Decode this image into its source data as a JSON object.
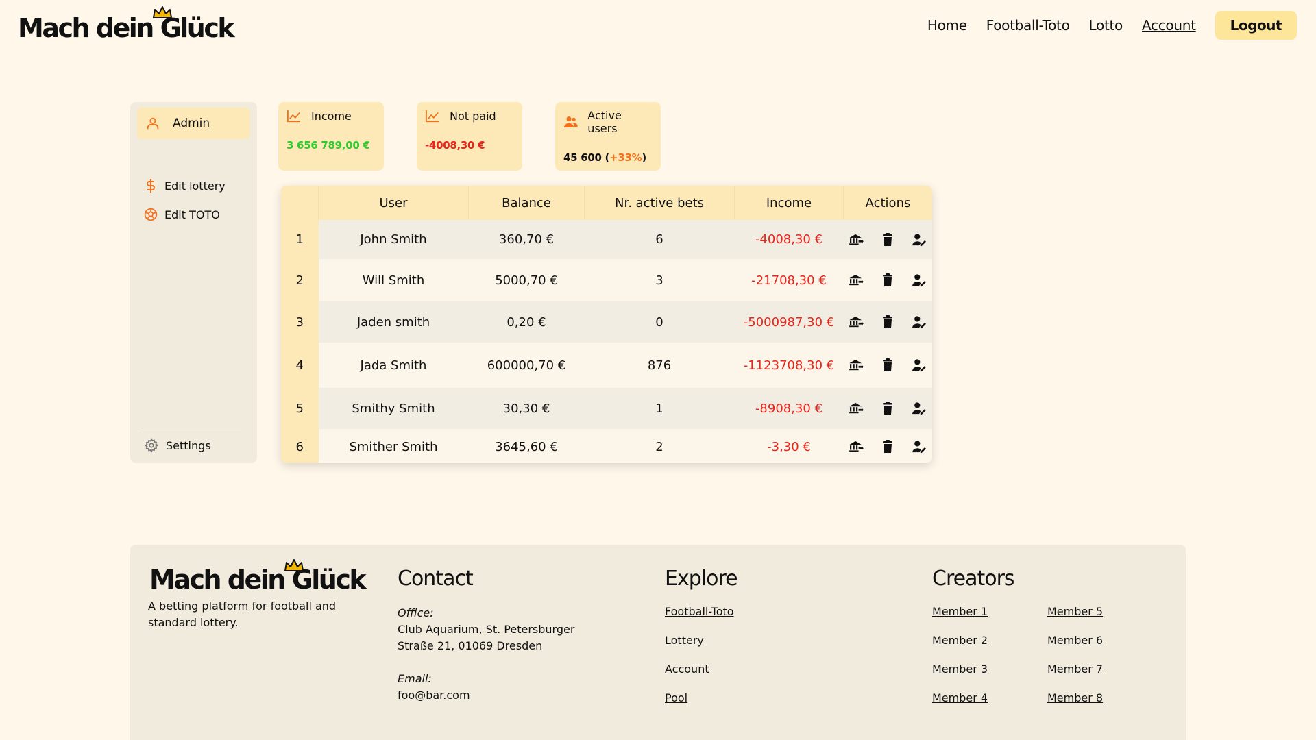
{
  "brand": {
    "name_part1": "Mach dein",
    "name_part2": "Glück"
  },
  "nav": {
    "items": [
      "Home",
      "Football-Toto",
      "Lotto",
      "Account"
    ],
    "logout_label": "Logout"
  },
  "sidebar": {
    "admin_label": "Admin",
    "items": [
      {
        "label": "Edit lottery",
        "icon": "dollar-icon"
      },
      {
        "label": "Edit TOTO",
        "icon": "soccer-ball-icon"
      }
    ],
    "settings_label": "Settings"
  },
  "stats": [
    {
      "label": "Income",
      "value": "3 656 789,00 €",
      "icon": "chart-line-icon"
    },
    {
      "label": "Not paid",
      "value": "-4008,30 €",
      "icon": "chart-line-icon"
    },
    {
      "label": "Active users",
      "value": "45 600",
      "delta": "+33%",
      "icon": "users-icon"
    }
  ],
  "table": {
    "headers": [
      "User",
      "Balance",
      "Nr. active bets",
      "Income",
      "Actions"
    ],
    "rows": [
      {
        "idx": "1",
        "user": "John Smith",
        "balance": "360,70 €",
        "bets": "6",
        "income": "-4008,30 €"
      },
      {
        "idx": "2",
        "user": "Will Smith",
        "balance": "5000,70 €",
        "bets": "3",
        "income": "-21708,30 €"
      },
      {
        "idx": "3",
        "user": "Jaden smith",
        "balance": "0,20 €",
        "bets": "0",
        "income": "-5000987,30 €"
      },
      {
        "idx": "4",
        "user": "Jada Smith",
        "balance": "600000,70 €",
        "bets": "876",
        "income": "-1123708,30 €"
      },
      {
        "idx": "5",
        "user": "Smithy Smith",
        "balance": "30,30 €",
        "bets": "1",
        "income": "-8908,30 €"
      },
      {
        "idx": "6",
        "user": "Smither Smith",
        "balance": "3645,60 €",
        "bets": "2",
        "income": "-3,30 €"
      }
    ]
  },
  "footer": {
    "description": "A betting platform for football and standard lottery.",
    "contact": {
      "title": "Contact",
      "office_label": "Office:",
      "office_line1": "Club Aquarium, St. Petersburger",
      "office_line2": "Straße 21, 01069 Dresden",
      "email_label": "Email:",
      "email": "foo@bar.com"
    },
    "explore": {
      "title": "Explore",
      "links": [
        "Football-Toto",
        "Lottery",
        "Account",
        "Pool"
      ]
    },
    "creators": {
      "title": "Creators",
      "members": [
        "Member 1",
        "Member 2",
        "Member 3",
        "Member 4",
        "Member 5",
        "Member 6",
        "Member 7",
        "Member 8"
      ]
    }
  },
  "colors": {
    "background": "#fef7ea",
    "accent_yellow": "#fde9b8",
    "positive_green": "#2ecc2e",
    "negative_red": "#e8241b",
    "orange": "#f2711c"
  }
}
